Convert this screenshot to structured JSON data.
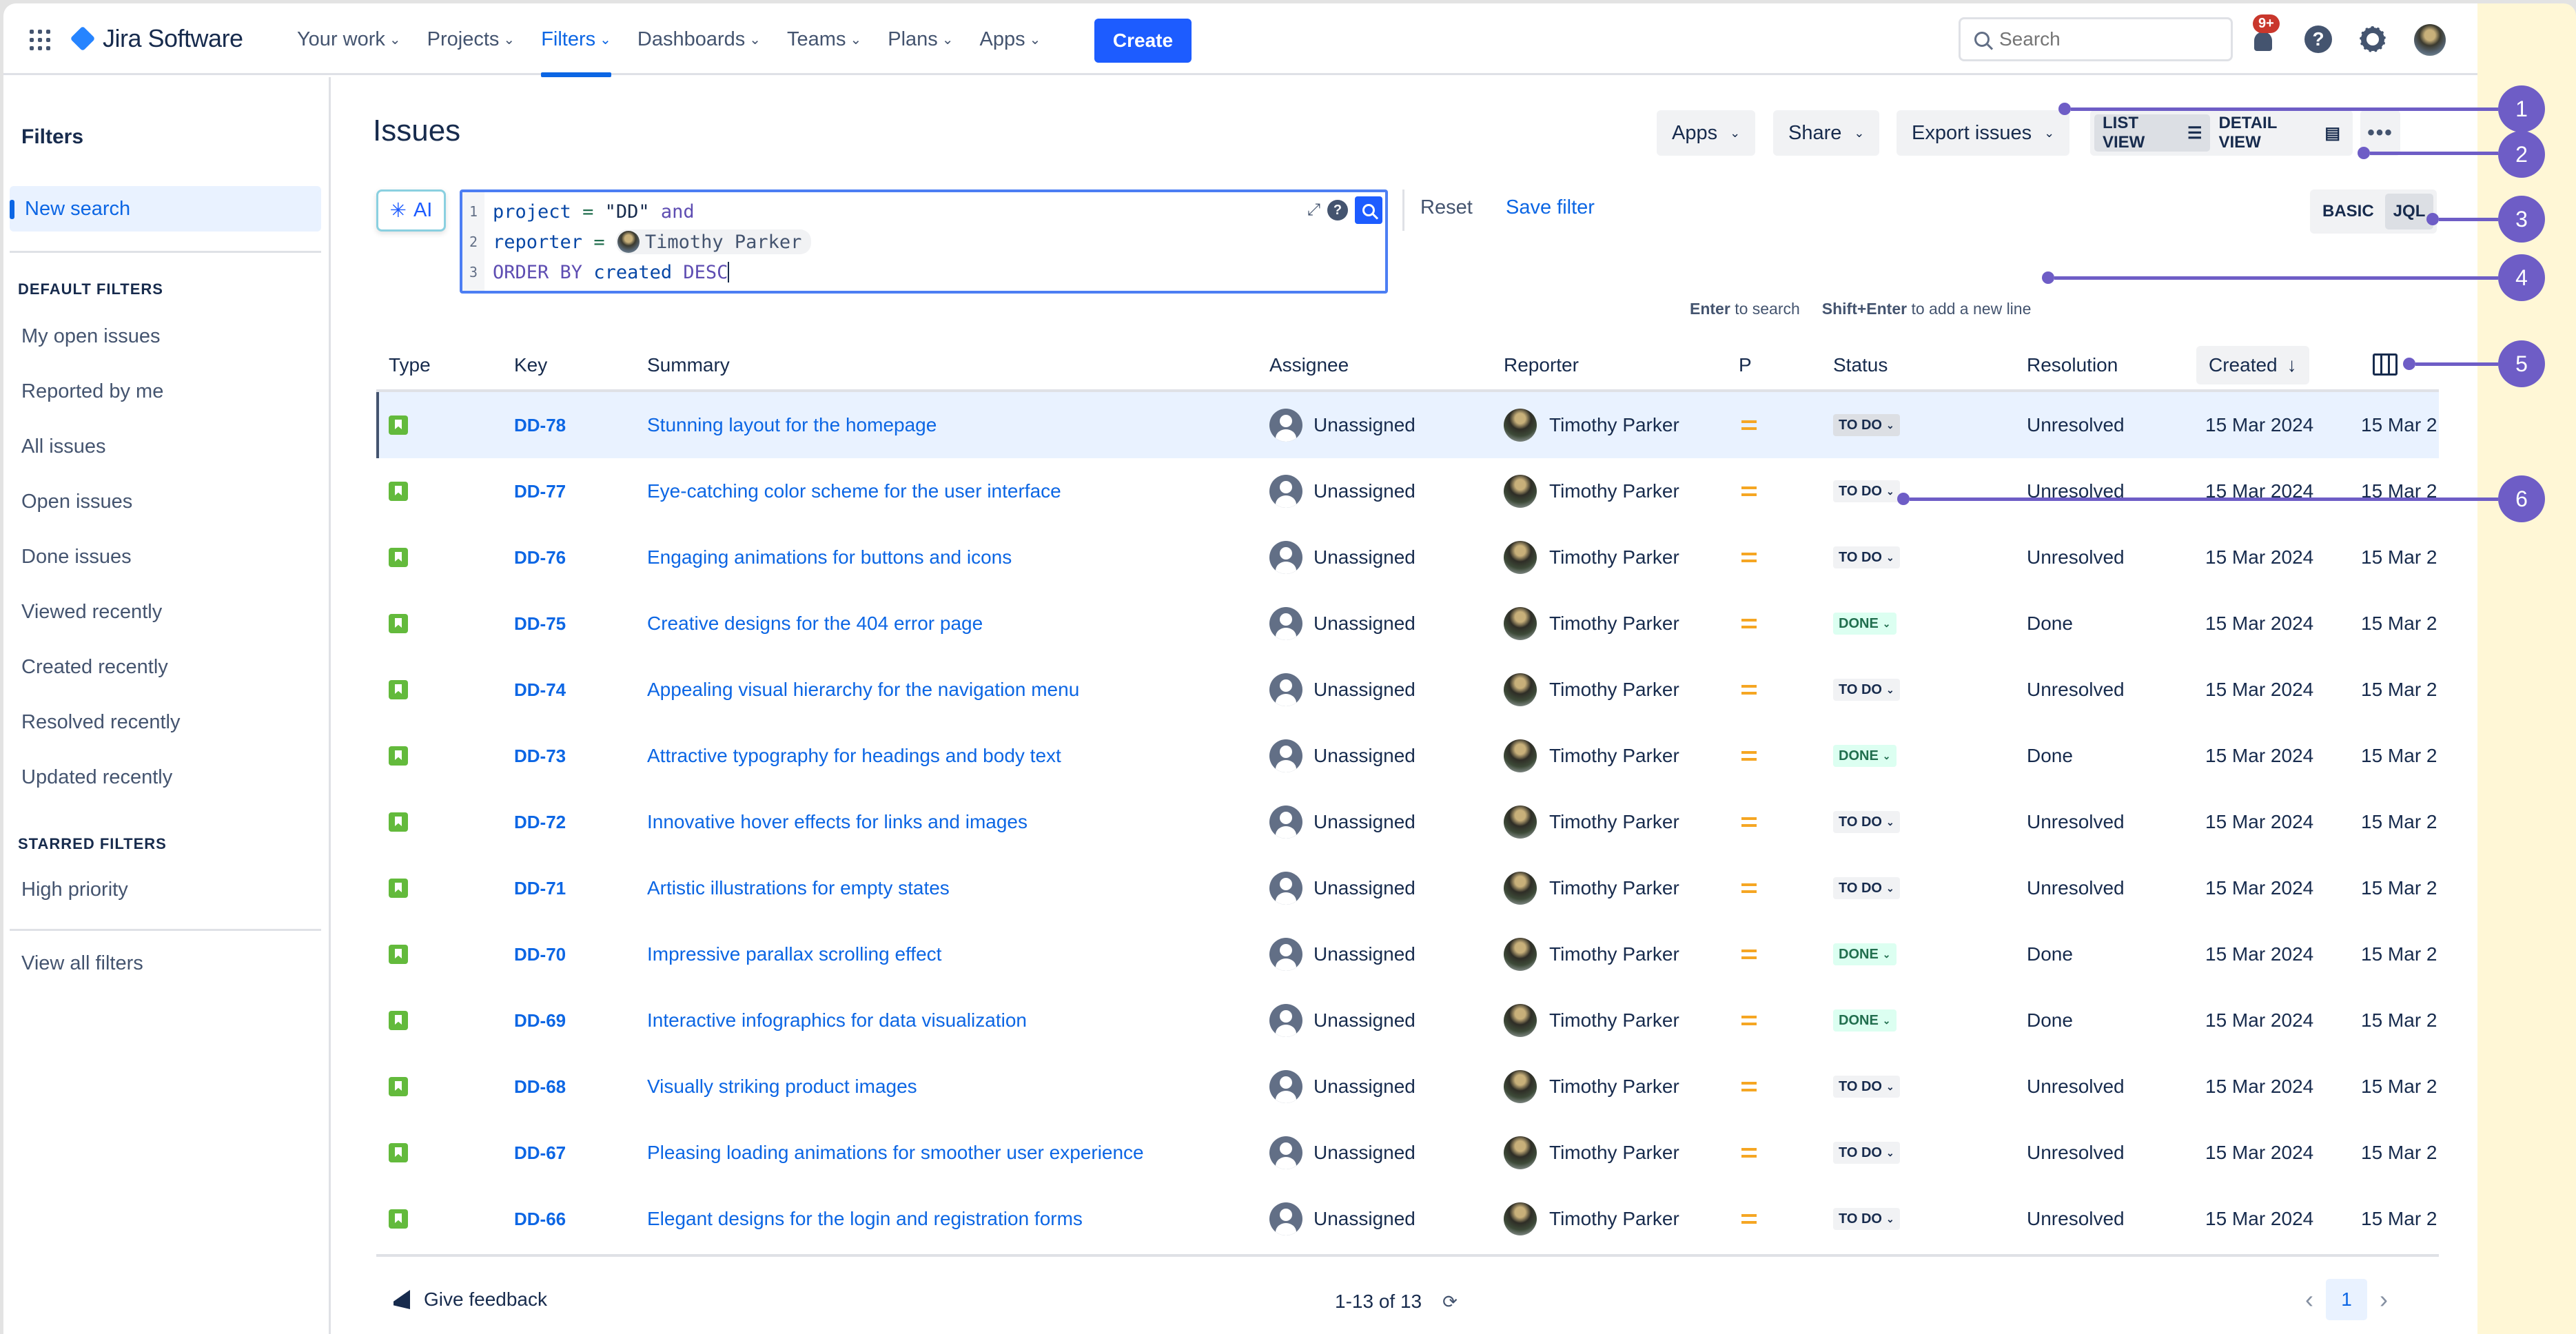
{
  "app": {
    "name": "Jira Software",
    "accent": "#1d5cff",
    "annotation_color": "#6e5dc6"
  },
  "nav": {
    "items": [
      {
        "label": "Your work",
        "active": false
      },
      {
        "label": "Projects",
        "active": false
      },
      {
        "label": "Filters",
        "active": true
      },
      {
        "label": "Dashboards",
        "active": false
      },
      {
        "label": "Teams",
        "active": false
      },
      {
        "label": "Plans",
        "active": false
      },
      {
        "label": "Apps",
        "active": false
      }
    ],
    "create_label": "Create",
    "search_placeholder": "Search",
    "notification_badge": "9+",
    "help_glyph": "?"
  },
  "sidebar": {
    "title": "Filters",
    "new_search": "New search",
    "default_heading": "DEFAULT FILTERS",
    "default_items": [
      "My open issues",
      "Reported by me",
      "All issues",
      "Open issues",
      "Done issues",
      "Viewed recently",
      "Created recently",
      "Resolved recently",
      "Updated recently"
    ],
    "starred_heading": "STARRED FILTERS",
    "starred_items": [
      "High priority"
    ],
    "view_all": "View all filters"
  },
  "header": {
    "title": "Issues",
    "apps_label": "Apps",
    "share_label": "Share",
    "export_label": "Export issues",
    "list_view_label": "LIST VIEW",
    "detail_view_label": "DETAIL VIEW",
    "more_label": "•••"
  },
  "query": {
    "ai_label": "AI",
    "lines": [
      {
        "num": "1",
        "field": "project",
        "op": "=",
        "value": "\"DD\"",
        "suffix": "and"
      },
      {
        "num": "2",
        "field": "reporter",
        "op": "=",
        "user": "Timothy Parker"
      },
      {
        "num": "3",
        "keyword": "ORDER BY",
        "field": "created",
        "suffix": "DESC"
      }
    ],
    "reset_label": "Reset",
    "save_filter_label": "Save filter",
    "basic_label": "BASIC",
    "jql_label": "JQL",
    "hint_enter_key": "Enter",
    "hint_enter_text": "to search",
    "hint_shift_key": "Shift+Enter",
    "hint_shift_text": "to add a new line"
  },
  "table": {
    "columns": [
      "Type",
      "Key",
      "Summary",
      "Assignee",
      "Reporter",
      "P",
      "Status",
      "Resolution",
      "Created"
    ],
    "sort_arrow": "↓",
    "rows": [
      {
        "key": "DD-78",
        "summary": "Stunning layout for the homepage",
        "assignee": "Unassigned",
        "reporter": "Timothy Parker",
        "status": "TO DO",
        "status_type": "todo",
        "resolution": "Unresolved",
        "created": "15 Mar 2024",
        "updated": "15 Mar 2",
        "selected": true
      },
      {
        "key": "DD-77",
        "summary": "Eye-catching color scheme for the user interface",
        "assignee": "Unassigned",
        "reporter": "Timothy Parker",
        "status": "TO DO",
        "status_type": "todo",
        "resolution": "Unresolved",
        "created": "15 Mar 2024",
        "updated": "15 Mar 2"
      },
      {
        "key": "DD-76",
        "summary": "Engaging animations for buttons and icons",
        "assignee": "Unassigned",
        "reporter": "Timothy Parker",
        "status": "TO DO",
        "status_type": "todo",
        "resolution": "Unresolved",
        "created": "15 Mar 2024",
        "updated": "15 Mar 2"
      },
      {
        "key": "DD-75",
        "summary": "Creative designs for the 404 error page",
        "assignee": "Unassigned",
        "reporter": "Timothy Parker",
        "status": "DONE",
        "status_type": "done",
        "resolution": "Done",
        "created": "15 Mar 2024",
        "updated": "15 Mar 2"
      },
      {
        "key": "DD-74",
        "summary": "Appealing visual hierarchy for the navigation menu",
        "assignee": "Unassigned",
        "reporter": "Timothy Parker",
        "status": "TO DO",
        "status_type": "todo",
        "resolution": "Unresolved",
        "created": "15 Mar 2024",
        "updated": "15 Mar 2"
      },
      {
        "key": "DD-73",
        "summary": "Attractive typography for headings and body text",
        "assignee": "Unassigned",
        "reporter": "Timothy Parker",
        "status": "DONE",
        "status_type": "done",
        "resolution": "Done",
        "created": "15 Mar 2024",
        "updated": "15 Mar 2"
      },
      {
        "key": "DD-72",
        "summary": "Innovative hover effects for links and images",
        "assignee": "Unassigned",
        "reporter": "Timothy Parker",
        "status": "TO DO",
        "status_type": "todo",
        "resolution": "Unresolved",
        "created": "15 Mar 2024",
        "updated": "15 Mar 2"
      },
      {
        "key": "DD-71",
        "summary": "Artistic illustrations for empty states",
        "assignee": "Unassigned",
        "reporter": "Timothy Parker",
        "status": "TO DO",
        "status_type": "todo",
        "resolution": "Unresolved",
        "created": "15 Mar 2024",
        "updated": "15 Mar 2"
      },
      {
        "key": "DD-70",
        "summary": "Impressive parallax scrolling effect",
        "assignee": "Unassigned",
        "reporter": "Timothy Parker",
        "status": "DONE",
        "status_type": "done",
        "resolution": "Done",
        "created": "15 Mar 2024",
        "updated": "15 Mar 2"
      },
      {
        "key": "DD-69",
        "summary": "Interactive infographics for data visualization",
        "assignee": "Unassigned",
        "reporter": "Timothy Parker",
        "status": "DONE",
        "status_type": "done",
        "resolution": "Done",
        "created": "15 Mar 2024",
        "updated": "15 Mar 2"
      },
      {
        "key": "DD-68",
        "summary": "Visually striking product images",
        "assignee": "Unassigned",
        "reporter": "Timothy Parker",
        "status": "TO DO",
        "status_type": "todo",
        "resolution": "Unresolved",
        "created": "15 Mar 2024",
        "updated": "15 Mar 2"
      },
      {
        "key": "DD-67",
        "summary": "Pleasing loading animations for smoother user experience",
        "assignee": "Unassigned",
        "reporter": "Timothy Parker",
        "status": "TO DO",
        "status_type": "todo",
        "resolution": "Unresolved",
        "created": "15 Mar 2024",
        "updated": "15 Mar 2"
      },
      {
        "key": "DD-66",
        "summary": "Elegant designs for the login and registration forms",
        "assignee": "Unassigned",
        "reporter": "Timothy Parker",
        "status": "TO DO",
        "status_type": "todo",
        "resolution": "Unresolved",
        "created": "15 Mar 2024",
        "updated": "15 Mar 2"
      }
    ]
  },
  "footer": {
    "feedback_label": "Give feedback",
    "count_label": "1-13 of 13",
    "current_page": "1"
  },
  "callouts": [
    "1",
    "2",
    "3",
    "4",
    "5",
    "6"
  ]
}
